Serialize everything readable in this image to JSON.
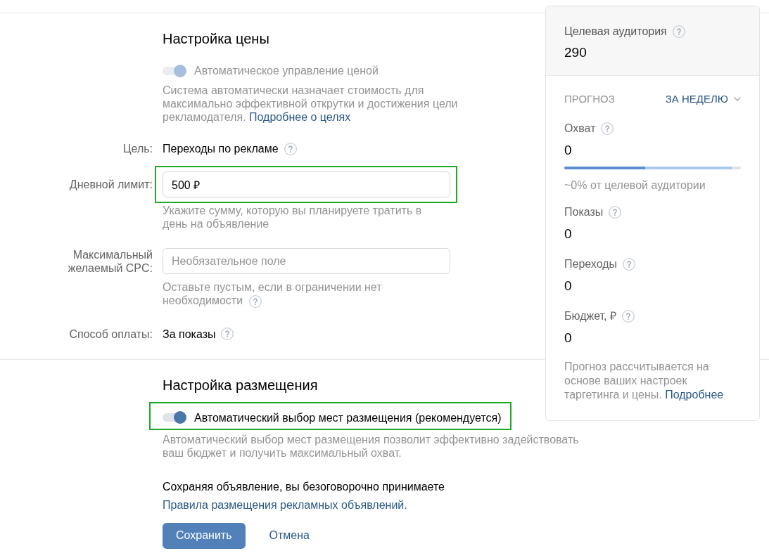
{
  "price_settings": {
    "title": "Настройка цены",
    "auto_price": {
      "label": "Автоматическое управление ценой",
      "on": true,
      "disabled": true
    },
    "description": "Система автоматически назначает стоимость для максимально эффективной открутки и достижения цели рекламодателя.",
    "description_link": "Подробнее о целях",
    "fields": [
      {
        "kind": "static",
        "label": "Цель:",
        "value": "Переходы по рекламе",
        "help": true
      },
      {
        "kind": "input",
        "label": "Дневной лимит:",
        "value": "500 ₽",
        "hint": "Укажите сумму, которую вы планируете тратить в день на объявление",
        "hint_help": false,
        "highlighted": true
      },
      {
        "kind": "input",
        "label": "Максимальный желаемый CPC:",
        "placeholder": "Необязательное поле",
        "hint": "Оставьте пустым, если в ограничении нет необходимости",
        "hint_help": true,
        "highlighted": false
      },
      {
        "kind": "static",
        "label": "Способ оплаты:",
        "value": "За показы",
        "help": true
      }
    ]
  },
  "placement_settings": {
    "title": "Настройка размещения",
    "auto_placement": {
      "label": "Автоматический выбор мест размещения (рекомендуется)",
      "on": true,
      "disabled": false,
      "highlighted": true
    },
    "description": "Автоматический выбор мест размещения позволит эффективно задействовать ваш бюджет и получить максимальный охват."
  },
  "agreement": {
    "text": "Сохраняя объявление, вы безоговорочно принимаете",
    "link": "Правила размещения рекламных объявлений."
  },
  "buttons": [
    {
      "kind": "primary",
      "label": "Сохранить"
    },
    {
      "kind": "link",
      "label": "Отмена"
    }
  ],
  "forecast_panel": {
    "audience": {
      "label": "Целевая аудитория",
      "value": "290",
      "help": true
    },
    "title": "ПРОГНОЗ",
    "period": "ЗА НЕДЕЛЮ",
    "metrics": [
      {
        "kind": "reach",
        "label": "Охват",
        "value": "0",
        "help": true,
        "bar": {
          "segments": [
            {
              "level": 0.46,
              "color": "#5b8ed3"
            },
            {
              "level": 0.95,
              "color": "#a9c9ef"
            }
          ]
        },
        "caption": "~0% от целевой аудитории"
      },
      {
        "kind": "plain",
        "label": "Показы",
        "value": "0",
        "help": true
      },
      {
        "kind": "plain",
        "label": "Переходы",
        "value": "0",
        "help": true
      },
      {
        "kind": "plain",
        "label": "Бюджет, ₽",
        "value": "0",
        "help": true
      }
    ],
    "note": "Прогноз рассчитывается на основе ваших настроек таргетинга и цены.",
    "note_link": "Подробнее"
  }
}
